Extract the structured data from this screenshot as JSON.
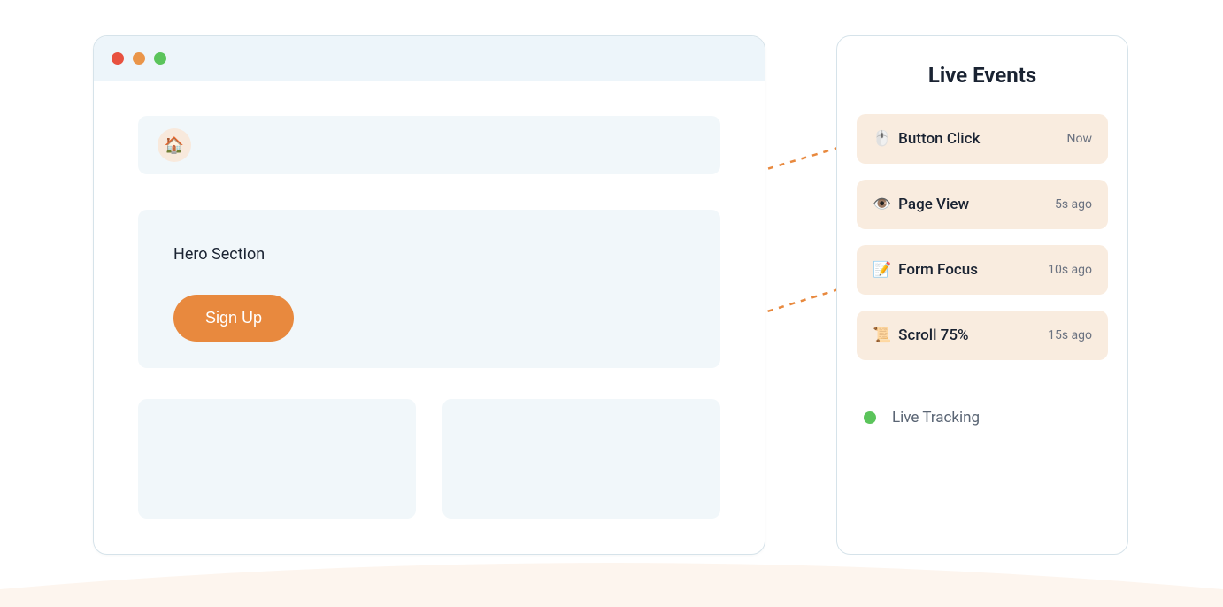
{
  "browser": {
    "nav_icon": "🏠",
    "hero_label": "Hero Section",
    "signup_label": "Sign Up"
  },
  "events_panel": {
    "title": "Live Events",
    "events": [
      {
        "icon": "🖱️",
        "label": "Button Click",
        "time": "Now"
      },
      {
        "icon": "👁️",
        "label": "Page View",
        "time": "5s ago"
      },
      {
        "icon": "📝",
        "label": "Form Focus",
        "time": "10s ago"
      },
      {
        "icon": "📜",
        "label": "Scroll 75%",
        "time": "15s ago"
      }
    ],
    "live_tracking_label": "Live Tracking"
  },
  "colors": {
    "accent": "#e8893e",
    "panel_bg": "#f1f7fa",
    "event_bg": "#f9ecdf"
  }
}
